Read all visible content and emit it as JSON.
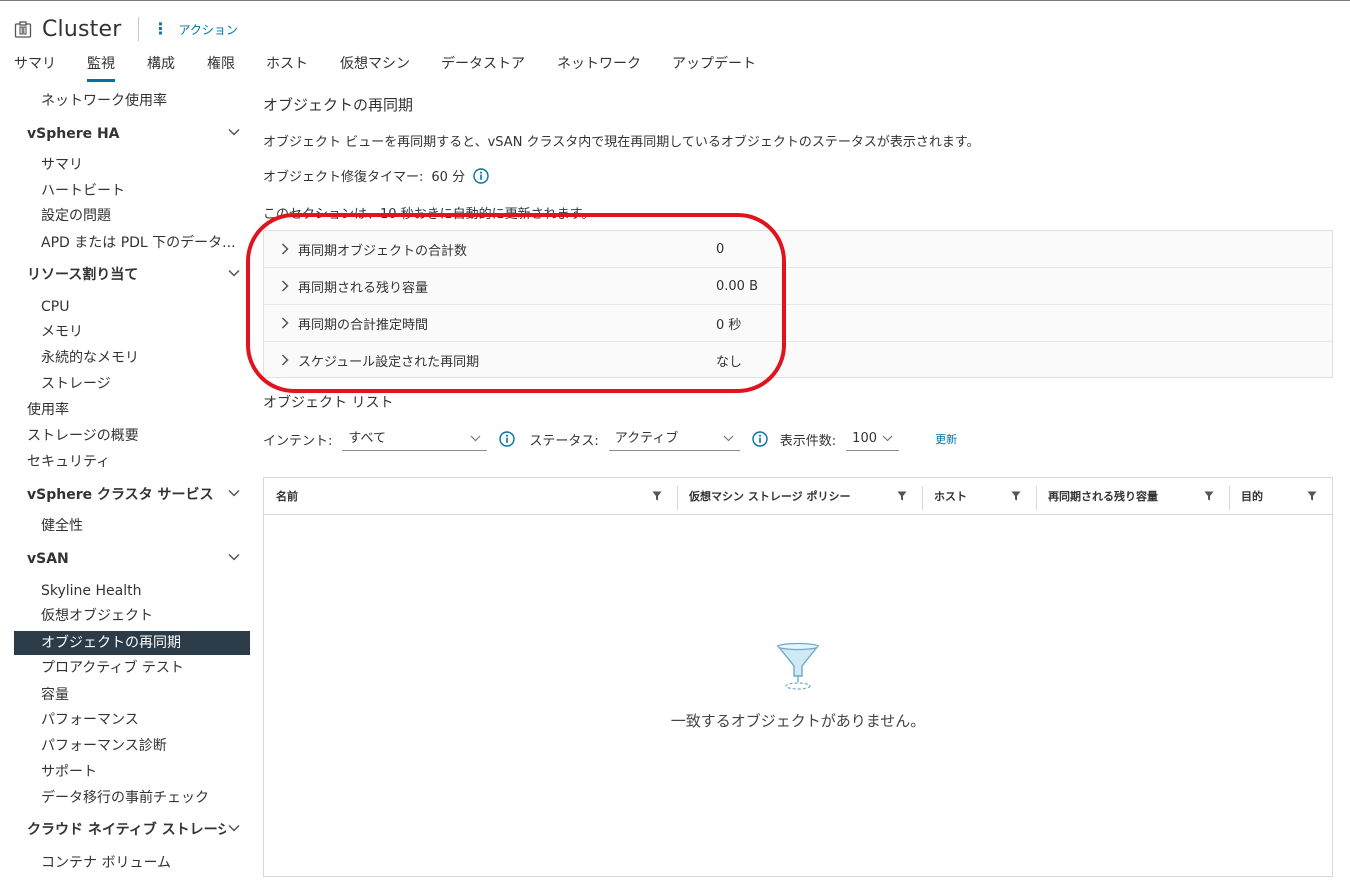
{
  "header": {
    "title": "Cluster",
    "actions_label": "アクション"
  },
  "tabs": [
    "サマリ",
    "監視",
    "構成",
    "権限",
    "ホスト",
    "仮想マシン",
    "データストア",
    "ネットワーク",
    "アップデート"
  ],
  "active_tab": "監視",
  "sidebar": {
    "items": [
      {
        "label": "ネットワーク使用率",
        "kind": "child"
      },
      {
        "label": "vSphere HA",
        "kind": "group"
      },
      {
        "label": "サマリ",
        "kind": "child"
      },
      {
        "label": "ハートビート",
        "kind": "child"
      },
      {
        "label": "設定の問題",
        "kind": "child"
      },
      {
        "label": "APD または PDL 下のデータ...",
        "kind": "child"
      },
      {
        "label": "リソース割り当て",
        "kind": "group"
      },
      {
        "label": "CPU",
        "kind": "child"
      },
      {
        "label": "メモリ",
        "kind": "child"
      },
      {
        "label": "永続的なメモリ",
        "kind": "child"
      },
      {
        "label": "ストレージ",
        "kind": "child"
      },
      {
        "label": "使用率",
        "kind": "root"
      },
      {
        "label": "ストレージの概要",
        "kind": "root"
      },
      {
        "label": "セキュリティ",
        "kind": "root"
      },
      {
        "label": "vSphere クラスタ サービス",
        "kind": "group"
      },
      {
        "label": "健全性",
        "kind": "child"
      },
      {
        "label": "vSAN",
        "kind": "group"
      },
      {
        "label": "Skyline Health",
        "kind": "child"
      },
      {
        "label": "仮想オブジェクト",
        "kind": "child"
      },
      {
        "label": "オブジェクトの再同期",
        "kind": "child",
        "selected": true
      },
      {
        "label": "プロアクティブ テスト",
        "kind": "child"
      },
      {
        "label": "容量",
        "kind": "child"
      },
      {
        "label": "パフォーマンス",
        "kind": "child"
      },
      {
        "label": "パフォーマンス診断",
        "kind": "child"
      },
      {
        "label": "サポート",
        "kind": "child"
      },
      {
        "label": "データ移行の事前チェック",
        "kind": "child"
      },
      {
        "label": "クラウド ネイティブ ストレージ",
        "kind": "group"
      },
      {
        "label": "コンテナ ボリューム",
        "kind": "child"
      }
    ]
  },
  "main": {
    "title": "オブジェクトの再同期",
    "description": "オブジェクト ビューを再同期すると、vSAN クラスタ内で現在再同期しているオブジェクトのステータスが表示されます。",
    "timer_label": "オブジェクト修復タイマー:",
    "timer_value": "60 分",
    "auto_refresh": "このセクションは、10 秒おきに自動的に更新されます。",
    "summary": [
      {
        "label": "再同期オブジェクトの合計数",
        "value": "0"
      },
      {
        "label": "再同期される残り容量",
        "value": "0.00 B"
      },
      {
        "label": "再同期の合計推定時間",
        "value": "0 秒"
      },
      {
        "label": "スケジュール設定された再同期",
        "value": "なし"
      }
    ],
    "object_list_title": "オブジェクト リスト",
    "filters": {
      "intent_label": "インテント:",
      "intent_value": "すべて",
      "status_label": "ステータス:",
      "status_value": "アクティブ",
      "count_label": "表示件数:",
      "count_value": "100",
      "refresh_label": "更新"
    },
    "table": {
      "columns": [
        "名前",
        "仮想マシン ストレージ ポリシー",
        "ホスト",
        "再同期される残り容量",
        "目的"
      ],
      "empty_message": "一致するオブジェクトがありません。"
    }
  },
  "colors": {
    "accent": "#0072a3",
    "selected_bg": "#2b3c48",
    "highlight": "#e0141e"
  }
}
